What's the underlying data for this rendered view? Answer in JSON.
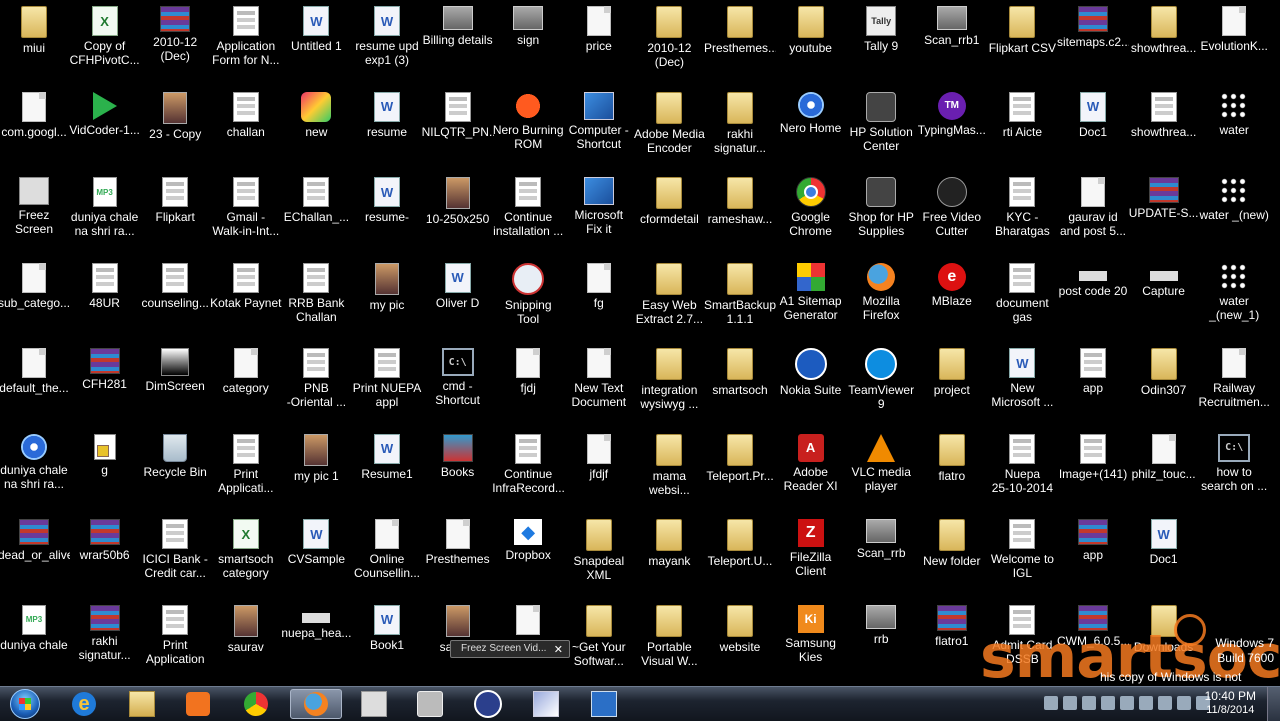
{
  "desktop": {
    "columns": [
      [
        [
          "folder",
          "miui"
        ],
        [
          "doc",
          "com.googl..."
        ],
        [
          "photo-exe",
          "Freez Screen\nVideo Cap..."
        ],
        [
          "doc",
          "sub_catego..."
        ],
        [
          "doc",
          "default_the..."
        ],
        [
          "disk",
          "duniya chale\nna shri ra..."
        ],
        [
          "rar",
          "dead_or_alive"
        ],
        [
          "mp3",
          "duniya chale"
        ]
      ],
      [
        [
          "excel",
          "Copy of\nCFHPivotC..."
        ],
        [
          "green",
          "VidCoder-1..."
        ],
        [
          "mp3",
          "duniya chale\nna shri ra..."
        ],
        [
          "web",
          "48UR"
        ],
        [
          "rar",
          "CFH281"
        ],
        [
          "g",
          "g"
        ],
        [
          "rar",
          "wrar50b6"
        ],
        [
          "rar",
          "rakhi\nsignatur..."
        ]
      ],
      [
        [
          "rar",
          "2010-12\n(Dec)"
        ],
        [
          "photo",
          "23 - Copy"
        ],
        [
          "web",
          "Flipkart"
        ],
        [
          "web",
          "counseling..."
        ],
        [
          "dim",
          "DimScreen"
        ],
        [
          "recycle",
          "Recycle Bin"
        ],
        [
          "web",
          "ICICI Bank -\nCredit car..."
        ],
        [
          "web",
          "Print\nApplication"
        ]
      ],
      [
        [
          "web",
          "Application\nForm for N..."
        ],
        [
          "web",
          "challan"
        ],
        [
          "web",
          "Gmail -\nWalk-in-Int..."
        ],
        [
          "web",
          "Kotak Paynet"
        ],
        [
          "doc",
          "category"
        ],
        [
          "web",
          "Print\nApplicati..."
        ],
        [
          "excel",
          "smartsoch\ncategory"
        ],
        [
          "photo",
          "saurav"
        ]
      ],
      [
        [
          "word",
          "Untitled 1"
        ],
        [
          "app",
          "new"
        ],
        [
          "web",
          "EChallan_..."
        ],
        [
          "web",
          "RRB Bank\nChallan"
        ],
        [
          "web",
          "PNB\n-Oriental ..."
        ],
        [
          "photo",
          "my pic 1"
        ],
        [
          "word",
          "CVSample"
        ],
        [
          "blank",
          "nuepa_hea..."
        ]
      ],
      [
        [
          "word",
          "resume upd\nexp1 (3)"
        ],
        [
          "word",
          "resume"
        ],
        [
          "word",
          "resume-"
        ],
        [
          "photo",
          "my pic"
        ],
        [
          "web",
          "Print NUEPA\nappl"
        ],
        [
          "word",
          "Resume1"
        ],
        [
          "doc",
          "Online\nCounsellin..."
        ],
        [
          "word",
          "Book1"
        ]
      ],
      [
        [
          "img",
          "Billing details"
        ],
        [
          "web",
          "NILQTR_PN..."
        ],
        [
          "photo",
          "10-250x250"
        ],
        [
          "word",
          "Oliver D"
        ],
        [
          "cmd",
          "cmd -\nShortcut"
        ],
        [
          "book",
          "Books"
        ],
        [
          "doc",
          "Presthemes"
        ],
        [
          "photo",
          "saurav"
        ]
      ],
      [
        [
          "img",
          "sign"
        ],
        [
          "nero",
          "Nero Burning\nROM"
        ],
        [
          "web",
          "Continue\ninstallation ..."
        ],
        [
          "snip",
          "Snipping\nTool"
        ],
        [
          "doc",
          "fjdj"
        ],
        [
          "web",
          "Continue\nInfraRecord..."
        ],
        [
          "dropbox",
          "Dropbox"
        ],
        [
          "doc",
          ""
        ]
      ],
      [
        [
          "doc",
          "price"
        ],
        [
          "win",
          "Computer -\nShortcut"
        ],
        [
          "win",
          "Microsoft\nFix it"
        ],
        [
          "doc",
          "fg"
        ],
        [
          "doc",
          "New Text\nDocument"
        ],
        [
          "doc",
          "jfdjf"
        ],
        [
          "folder",
          "Snapdeal\nXML"
        ],
        [
          "folder",
          "~Get Your\nSoftwar..."
        ]
      ],
      [
        [
          "folder",
          "2010-12\n(Dec)"
        ],
        [
          "folder",
          "Adobe Media\nEncoder CS..."
        ],
        [
          "folder",
          "cformdetail"
        ],
        [
          "folder",
          "Easy Web\nExtract 2.7..."
        ],
        [
          "folder",
          "integration\nwysiwyg ..."
        ],
        [
          "folder",
          "mama\nwebsi..."
        ],
        [
          "folder",
          "mayank"
        ],
        [
          "folder",
          "Portable\nVisual W..."
        ]
      ],
      [
        [
          "folder",
          "Presthemes..."
        ],
        [
          "folder",
          "rakhi\nsignatur..."
        ],
        [
          "folder",
          "rameshaw..."
        ],
        [
          "folder",
          "SmartBackup\n1.1.1"
        ],
        [
          "folder",
          "smartsoch"
        ],
        [
          "folder",
          "Teleport.Pr..."
        ],
        [
          "folder",
          "Teleport.U..."
        ],
        [
          "folder",
          "website"
        ]
      ],
      [
        [
          "folder",
          "youtube"
        ],
        [
          "disk",
          "Nero Home"
        ],
        [
          "chrome",
          "Google\nChrome"
        ],
        [
          "a1",
          "A1 Sitemap\nGenerator"
        ],
        [
          "nokia",
          "Nokia Suite"
        ],
        [
          "pdf",
          "Adobe\nReader XI"
        ],
        [
          "fz",
          "FileZilla\nClient"
        ],
        [
          "ki",
          "Samsung\nKies"
        ]
      ],
      [
        [
          "tally",
          "Tally 9"
        ],
        [
          "hp",
          "HP Solution\nCenter"
        ],
        [
          "hp",
          "Shop for HP\nSupplies"
        ],
        [
          "firefox",
          "Mozilla\nFirefox"
        ],
        [
          "tv",
          "TeamViewer\n9"
        ],
        [
          "vlc",
          "VLC media\nplayer"
        ],
        [
          "img",
          "Scan_rrb"
        ],
        [
          "img",
          "rrb"
        ]
      ],
      [
        [
          "img",
          "Scan_rrb1"
        ],
        [
          "type",
          "TypingMas..."
        ],
        [
          "vid",
          "Free Video\nCutter"
        ],
        [
          "mb",
          "MBlaze"
        ],
        [
          "folder",
          "project"
        ],
        [
          "folder",
          "flatro"
        ],
        [
          "folder",
          "New folder"
        ],
        [
          "rar",
          "flatro1"
        ]
      ],
      [
        [
          "folder",
          "Flipkart CSV"
        ],
        [
          "web",
          "rti Aicte"
        ],
        [
          "web",
          "KYC -\nBharatgas"
        ],
        [
          "web",
          "document\ngas"
        ],
        [
          "word",
          "New\nMicrosoft ..."
        ],
        [
          "web",
          "Nuepa\n25-10-2014"
        ],
        [
          "web",
          "Welcome to\nIGL"
        ],
        [
          "web",
          "Admit Card\nDSSB"
        ]
      ],
      [
        [
          "rar",
          "sitemaps.c2..."
        ],
        [
          "word",
          "Doc1"
        ],
        [
          "doc",
          "gaurav id\nand post 5..."
        ],
        [
          "blank",
          "post code 20"
        ],
        [
          "web",
          "app"
        ],
        [
          "web",
          "Image+(141)"
        ],
        [
          "rar",
          "app"
        ],
        [
          "rar",
          "CWM_6.0.5..."
        ]
      ],
      [
        [
          "folder",
          "showthrea..."
        ],
        [
          "web",
          "showthrea..."
        ],
        [
          "rar",
          "UPDATE-S..."
        ],
        [
          "blank",
          "Capture"
        ],
        [
          "folder",
          "Odin307"
        ],
        [
          "doc",
          "philz_touc..."
        ],
        [
          "word",
          "Doc1"
        ],
        [
          "folder",
          "Downloads"
        ]
      ],
      [
        [
          "doc",
          "EvolutionK..."
        ],
        [
          "water",
          "water"
        ],
        [
          "water",
          "water _(new)"
        ],
        [
          "water",
          "water\n_(new_1)"
        ],
        [
          "doc",
          "Railway\nRecruitmen..."
        ],
        [
          "cmd",
          "how to\nsearch on ..."
        ],
        [
          "none",
          ""
        ],
        [
          "none",
          ""
        ]
      ]
    ]
  },
  "floating_thumbnail": {
    "title": "Freez Screen Vid...",
    "close": "✕"
  },
  "watermark": {
    "line1": "Windows 7",
    "line2": "Build 7600",
    "genuine": "his copy of Windows is not genuine"
  },
  "brand": "smartsoch",
  "taskbar": {
    "pinned": [
      "ie",
      "folder",
      "media",
      "chrome",
      "firefox",
      "blank",
      "camera",
      "bluetooth",
      "pen",
      "monitor"
    ],
    "active": "firefox"
  },
  "clock": {
    "time": "10:40 PM",
    "date": "11/8/2014"
  }
}
